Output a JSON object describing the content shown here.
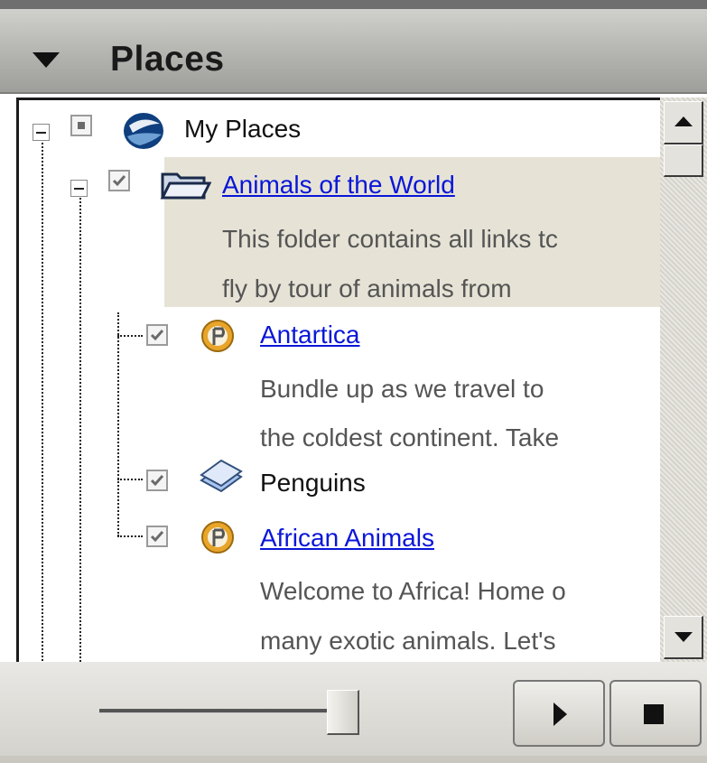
{
  "panel": {
    "title": "Places",
    "collapse_icon": "triangle-down-icon"
  },
  "tree": {
    "root": {
      "label": "My Places",
      "icon": "globe-icon"
    },
    "folder": {
      "label": "Animals of the World",
      "icon": "open-folder-icon",
      "description_line1": "This folder contains all links tc",
      "description_line2": "fly by tour of animals from"
    },
    "items": [
      {
        "label": "Antartica",
        "icon": "placemark-icon",
        "description_line1": "Bundle up as we travel to",
        "description_line2": "the coldest continent. Take"
      },
      {
        "label": "Penguins",
        "icon": "layer-overlay-icon"
      },
      {
        "label": "African Animals",
        "icon": "placemark-icon",
        "description_line1": "Welcome to Africa! Home o",
        "description_line2": "many exotic animals. Let's"
      }
    ]
  },
  "controls": {
    "play_icon": "play-icon",
    "stop_icon": "stop-icon",
    "slider_level": 0.98
  },
  "colors": {
    "link": "#0a16d8",
    "selection_bg": "#e6e3d6"
  }
}
